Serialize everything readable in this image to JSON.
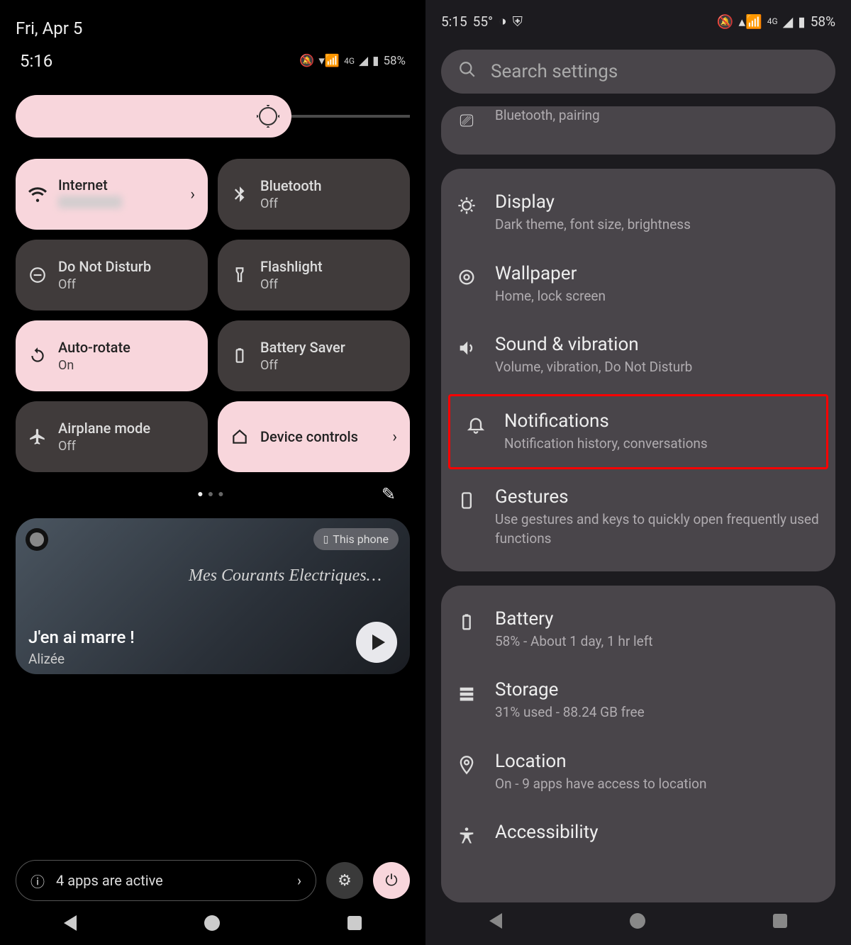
{
  "left": {
    "date": "Fri, Apr 5",
    "time": "5:16",
    "signal_label": "4G",
    "battery": "58%",
    "tiles": [
      {
        "title": "Internet",
        "sub": "",
        "on": true,
        "chevron": true,
        "icon": "wifi"
      },
      {
        "title": "Bluetooth",
        "sub": "Off",
        "on": false,
        "icon": "bluetooth"
      },
      {
        "title": "Do Not Disturb",
        "sub": "Off",
        "on": false,
        "icon": "dnd"
      },
      {
        "title": "Flashlight",
        "sub": "Off",
        "on": false,
        "icon": "flashlight"
      },
      {
        "title": "Auto-rotate",
        "sub": "On",
        "on": true,
        "icon": "rotate"
      },
      {
        "title": "Battery Saver",
        "sub": "Off",
        "on": false,
        "icon": "battery"
      },
      {
        "title": "Airplane mode",
        "sub": "Off",
        "on": false,
        "icon": "airplane"
      },
      {
        "title": "Device controls",
        "sub": "",
        "on": true,
        "chevron": true,
        "center": true,
        "icon": "home"
      }
    ],
    "media": {
      "device": "This phone",
      "album": "Mes Courants Electriques…",
      "song": "J'en ai marre !",
      "artist": "Alizée"
    },
    "apps_active": "4 apps are active"
  },
  "right": {
    "time": "5:15",
    "temp": "55°",
    "signal_label": "4G",
    "battery": "58%",
    "search_placeholder": "Search settings",
    "partial_sub": "Bluetooth, pairing",
    "items": [
      {
        "title": "Display",
        "sub": "Dark theme, font size, brightness",
        "icon": "display"
      },
      {
        "title": "Wallpaper",
        "sub": "Home, lock screen",
        "icon": "wallpaper"
      },
      {
        "title": "Sound & vibration",
        "sub": "Volume, vibration, Do Not Disturb",
        "icon": "sound"
      },
      {
        "title": "Notifications",
        "sub": "Notification history, conversations",
        "icon": "bell",
        "highlight": true
      },
      {
        "title": "Gestures",
        "sub": "Use gestures and keys to quickly open frequently used functions",
        "icon": "gestures"
      }
    ],
    "items2": [
      {
        "title": "Battery",
        "sub": "58% - About 1 day, 1 hr left",
        "icon": "battery"
      },
      {
        "title": "Storage",
        "sub": "31% used - 88.24 GB free",
        "icon": "storage"
      },
      {
        "title": "Location",
        "sub": "On - 9 apps have access to location",
        "icon": "location"
      },
      {
        "title": "Accessibility",
        "sub": "",
        "icon": "accessibility"
      }
    ]
  }
}
